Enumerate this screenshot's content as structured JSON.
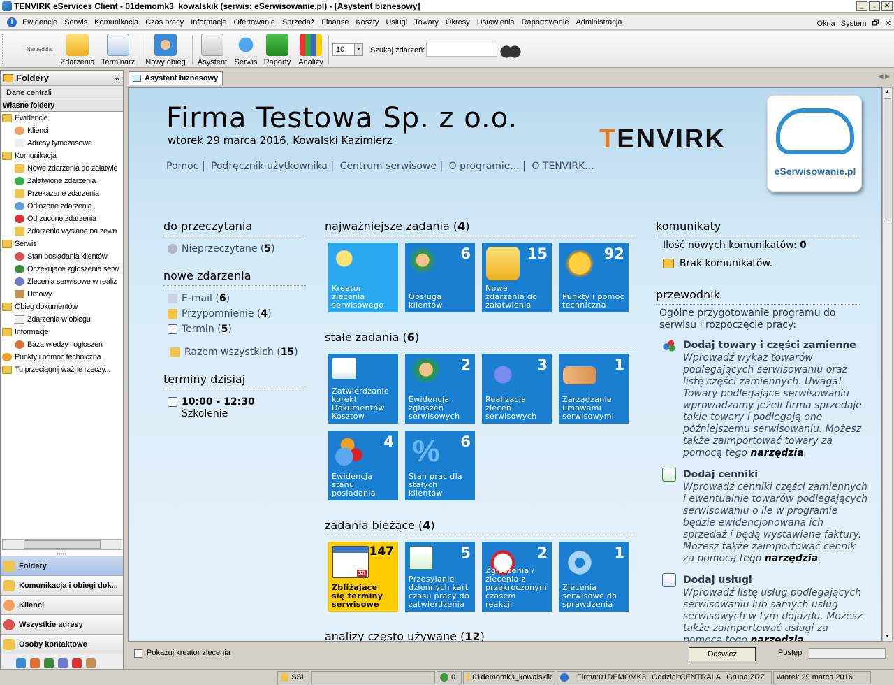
{
  "window": {
    "title": "TENVIRK eServices Client - 01demomk3_kowalskik (serwis: eSerwisowanie.pl) - [Asystent biznesowy]"
  },
  "menu": {
    "items": [
      "Ewidencje",
      "Serwis",
      "Komunikacja",
      "Czas pracy",
      "Informacje",
      "Ofertowanie",
      "Sprzedaż",
      "Finanse",
      "Koszty",
      "Usługi",
      "Towary",
      "Okresy",
      "Ustawienia",
      "Raportowanie",
      "Administracja"
    ],
    "right": {
      "okna": "Okna",
      "system": "System"
    }
  },
  "toolbar": {
    "label": "Narzędzia:",
    "buttons": [
      "Zdarzenia",
      "Terminarz",
      "Nowy obieg",
      "Asystent",
      "Serwis",
      "Raporty",
      "Analizy"
    ],
    "count_value": "10",
    "search_label": "Szukaj zdarzeń:"
  },
  "sidebar": {
    "title": "Foldery",
    "central": "Dane centrali",
    "own": "Własne foldery",
    "tree": [
      "Ewidencje",
      "Klienci",
      "Adresy tymczasowe",
      "Komunikacja",
      "Nowe zdarzenia do załatwie",
      "Załatwione zdarzenia",
      "Przekazane zdarzenia",
      "Odłożone zdarzenia",
      "Odrzucone zdarzenia",
      "Zdarzenia wysłane na zewn",
      "Serwis",
      "Stan posiadania klientów",
      "Oczekujące zgłoszenia serw",
      "Zlecenia serwisowe w realiz",
      "Umowy",
      "Obieg dokumentów",
      "Zdarzenia w obiegu",
      "Informacje",
      "Baza wiedzy i ogłoszeń",
      "Punkty i pomoc techniczna",
      "Tu przeciągnij ważne rzeczy..."
    ],
    "nav": [
      "Foldery",
      "Komunikacja i obiegi dok...",
      "Klienci",
      "Wszystkie adresy",
      "Osoby kontaktowe"
    ]
  },
  "tab": {
    "label": "Asystent biznesowy"
  },
  "header": {
    "company": "Firma Testowa Sp. z o.o.",
    "date_user": "wtorek 29 marca 2016, Kowalski Kazimierz",
    "links": [
      "Pomoc |",
      "Podręcznik użytkownika |",
      "Centrum serwisowe |",
      "O programie... |",
      "O TENVIRK..."
    ],
    "brand_t": "T",
    "brand_rest": "ENVIRK",
    "logo_text": "eSerwisowanie.pl"
  },
  "left": {
    "read_head": "do przeczytania",
    "unread_label": "Nieprzeczytane (",
    "unread_count": "5",
    "events_head": "nowe zdarzenia",
    "email_label": "E-mail (",
    "email_count": "6",
    "reminder_label": "Przypomnienie (",
    "reminder_count": "4",
    "term_label": "Termin (",
    "term_count": "5",
    "total_label": "Razem wszystkich (",
    "total_count": "15",
    "today_head": "terminy dzisiaj",
    "today_time": "10:00 - 12:30",
    "today_title": "Szkolenie",
    "close": ")"
  },
  "tasks": {
    "important_head": "najważniejsze zadania (",
    "important_count": "4",
    "important": [
      {
        "num": "",
        "label": "Kreator zlecenia serwisowego"
      },
      {
        "num": "6",
        "label": "Obsługa klientów"
      },
      {
        "num": "15",
        "label": "Nowe zdarzenia do załatwienia"
      },
      {
        "num": "92",
        "label": "Punkty i pomoc techniczna"
      }
    ],
    "fixed_head": "stałe zadania (",
    "fixed_count": "6",
    "fixed": [
      {
        "num": "",
        "label": "Zatwierdzanie korekt Dokumentów Kosztów"
      },
      {
        "num": "2",
        "label": "Ewidencja zgłoszeń serwisowych"
      },
      {
        "num": "3",
        "label": "Realizacja zleceń serwisowych"
      },
      {
        "num": "1",
        "label": "Zarządzanie umowami serwisowymi"
      },
      {
        "num": "4",
        "label": "Ewidencja stanu posiadania"
      },
      {
        "num": "6",
        "label": "Stan prac dla stałych klientów"
      }
    ],
    "current_head": "zadania bieżące (",
    "current_count": "4",
    "current": [
      {
        "num": "147",
        "label": "Zbliżające się terminy serwisowe",
        "cal": "30"
      },
      {
        "num": "5",
        "label": "Przesyłanie dziennych kart czasu pracy do zatwierdzenia"
      },
      {
        "num": "2",
        "label": "Zgłoszenia / zlecenia z przekroczonym czasem reakcji"
      },
      {
        "num": "1",
        "label": "Zlecenia serwisowe do sprawdzenia"
      }
    ],
    "analysis_head": "analizy często używane (",
    "analysis_count": "12",
    "close": ")"
  },
  "right": {
    "messages_head": "komunikaty",
    "new_messages_label": "Ilość nowych komunikatów:",
    "new_messages_count": "0",
    "no_messages": "Brak komunikatów.",
    "guide_head": "przewodnik",
    "guide_intro": "Ogólne przygotowanie programu do serwisu i rozpoczęcie pracy:",
    "guide": [
      {
        "title": "Dodaj towary i części zamienne",
        "text": "Wprowadź wykaz towarów podlegających serwisowaniu oraz listę części zamiennych. Uwaga! Towary podlegające serwisowaniu wprowadzamy jeżeli firma sprzedaje takie towary i podlegają one późniejszemu serwisowaniu. Możesz także zaimportować towary za pomocą tego ",
        "bold": "narzędzia",
        "end": "."
      },
      {
        "title": "Dodaj cenniki",
        "text": "Wprowadź cenniki części zamiennych i ewentualnie towarów podlegających serwisowaniu o ile w programie będzie ewidencjonowana ich sprzedaż i będą wystawiane faktury. Możesz także zaimportować cennik za pomocą tego ",
        "bold": "narzędzia",
        "end": "."
      },
      {
        "title": "Dodaj usługi",
        "text": "Wprowadź listę usług podlegających serwisowaniu lub samych usług serwisowych w tym dojazdu. Możesz także zaimportować usługi za pomocą tego ",
        "bold": "narzędzia",
        "end": "."
      }
    ]
  },
  "bottom": {
    "checkbox_label": "Pokazuj kreator zlecenia",
    "refresh": "Odśwież",
    "progress_label": "Postęp"
  },
  "status": {
    "ssl": "SSL",
    "users": "0",
    "login": "01demomk3_kowalskik",
    "firm": "Firma:01DEMOMK3",
    "branch": "Oddział:CENTRALA",
    "group": "Grupa:ZRZ",
    "date": "wtorek 29 marca 2016"
  }
}
